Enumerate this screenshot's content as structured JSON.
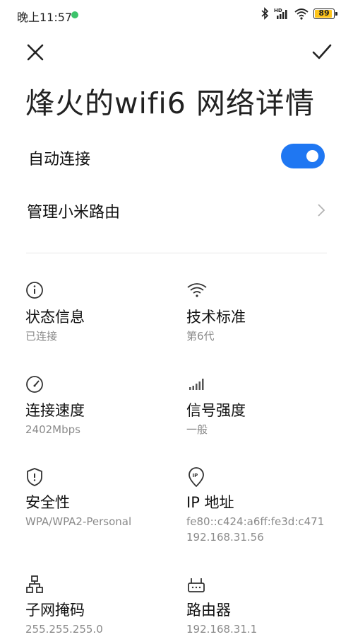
{
  "status_bar": {
    "time": "晚上11:57",
    "battery": "89",
    "icons": [
      "bluetooth-icon",
      "hd-signal-icon",
      "wifi-icon",
      "battery-icon"
    ]
  },
  "header": {
    "close_icon": "close-icon",
    "confirm_icon": "check-icon",
    "title": "烽火的wifi6 网络详情"
  },
  "settings": {
    "auto_connect_label": "自动连接",
    "auto_connect_on": true,
    "manage_router_label": "管理小米路由"
  },
  "details": [
    {
      "icon": "info-icon",
      "label": "状态信息",
      "value": "已连接"
    },
    {
      "icon": "wifi-standard-icon",
      "label": "技术标准",
      "value": "第6代"
    },
    {
      "icon": "speed-gauge-icon",
      "label": "连接速度",
      "value": "2402Mbps"
    },
    {
      "icon": "signal-strength-icon",
      "label": "信号强度",
      "value": "一般"
    },
    {
      "icon": "security-shield-icon",
      "label": "安全性",
      "value": "WPA/WPA2-Personal"
    },
    {
      "icon": "ip-location-icon",
      "label": "IP 地址",
      "value": "fe80::c424:a6ff:fe3d:c471\n192.168.31.56"
    },
    {
      "icon": "subnet-network-icon",
      "label": "子网掩码",
      "value": "255.255.255.0"
    },
    {
      "icon": "router-icon",
      "label": "路由器",
      "value": "192.168.31.1"
    }
  ],
  "colors": {
    "accent": "#1f77f2",
    "battery": "#ffc51a",
    "status_dot": "#3cc36a"
  }
}
